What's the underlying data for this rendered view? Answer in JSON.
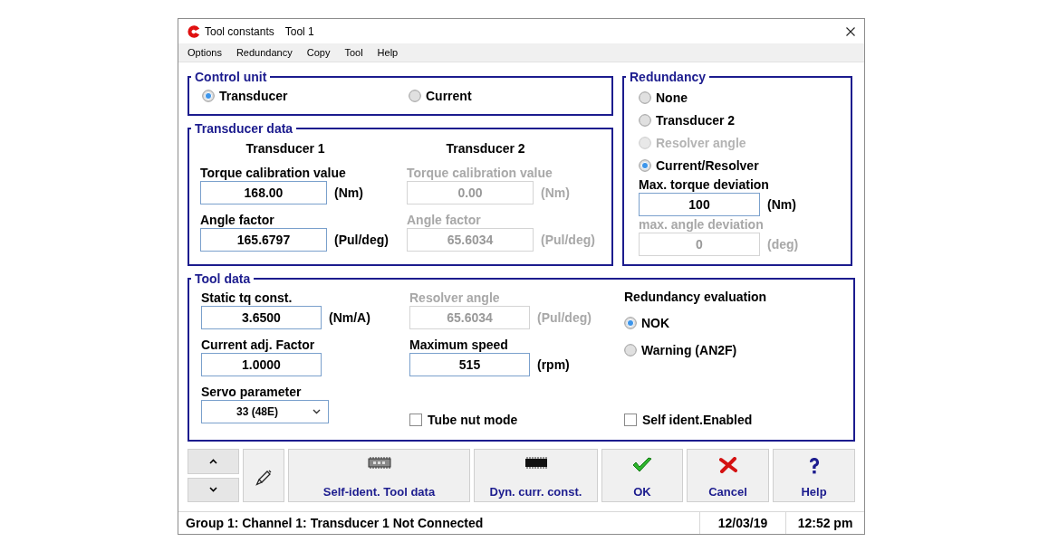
{
  "window": {
    "title": "Tool constants",
    "document": "Tool 1"
  },
  "menu": [
    "Options",
    "Redundancy",
    "Copy",
    "Tool",
    "Help"
  ],
  "control_unit": {
    "title": "Control unit",
    "options": [
      {
        "label": "Transducer",
        "selected": true
      },
      {
        "label": "Current",
        "selected": false
      }
    ]
  },
  "transducer_data": {
    "title": "Transducer data",
    "columns": [
      {
        "heading": "Transducer 1",
        "fields": [
          {
            "label": "Torque calibration value",
            "value": "168.00",
            "unit": "(Nm)",
            "disabled": false
          },
          {
            "label": "Angle factor",
            "value": "165.6797",
            "unit": "(Pul/deg)",
            "disabled": false
          }
        ]
      },
      {
        "heading": "Transducer 2",
        "fields": [
          {
            "label": "Torque calibration value",
            "value": "0.00",
            "unit": "(Nm)",
            "disabled": true
          },
          {
            "label": "Angle factor",
            "value": "65.6034",
            "unit": "(Pul/deg)",
            "disabled": true
          }
        ]
      }
    ]
  },
  "redundancy": {
    "title": "Redundancy",
    "options": [
      {
        "label": "None",
        "selected": false,
        "disabled": false
      },
      {
        "label": "Transducer 2",
        "selected": false,
        "disabled": false
      },
      {
        "label": "Resolver angle",
        "selected": false,
        "disabled": true
      },
      {
        "label": "Current/Resolver",
        "selected": true,
        "disabled": false
      }
    ],
    "fields": [
      {
        "label": "Max. torque deviation",
        "value": "100",
        "unit": "(Nm)",
        "disabled": false
      },
      {
        "label": "max. angle deviation",
        "value": "0",
        "unit": "(deg)",
        "disabled": true
      }
    ]
  },
  "tool_data": {
    "title": "Tool data",
    "columns": [
      {
        "items": [
          {
            "kind": "input",
            "label": "Static tq const.",
            "value": "3.6500",
            "unit": "(Nm/A)",
            "disabled": false
          },
          {
            "kind": "input",
            "label": "Current adj. Factor",
            "value": "1.0000",
            "disabled": false
          },
          {
            "kind": "select",
            "label": "Servo parameter",
            "value": "33 (48E)"
          }
        ]
      },
      {
        "items": [
          {
            "kind": "input",
            "label": "Resolver angle",
            "value": "65.6034",
            "unit": "(Pul/deg)",
            "disabled": true
          },
          {
            "kind": "input",
            "label": "Maximum speed",
            "value": "515",
            "unit": "(rpm)",
            "disabled": false
          },
          {
            "kind": "checkbox",
            "label": "Tube nut mode",
            "checked": false
          }
        ]
      },
      {
        "items": [
          {
            "kind": "heading",
            "label": "Redundancy evaluation"
          },
          {
            "kind": "radio",
            "label": "NOK",
            "selected": true
          },
          {
            "kind": "radio",
            "label": "Warning (AN2F)",
            "selected": false
          },
          {
            "kind": "checkbox",
            "label": "Self ident.Enabled",
            "checked": false
          }
        ]
      }
    ]
  },
  "toolbar": [
    {
      "kind": "chip",
      "label": "Self-ident. Tool data"
    },
    {
      "kind": "chip-dark",
      "label": "Dyn. curr. const."
    },
    {
      "kind": "ok",
      "label": "OK"
    },
    {
      "kind": "cancel",
      "label": "Cancel"
    },
    {
      "kind": "help",
      "label": "Help"
    }
  ],
  "status_bar": [
    "Group 1: Channel 1: Transducer 1 Not Connected",
    "12/03/19",
    "12:52 pm"
  ]
}
